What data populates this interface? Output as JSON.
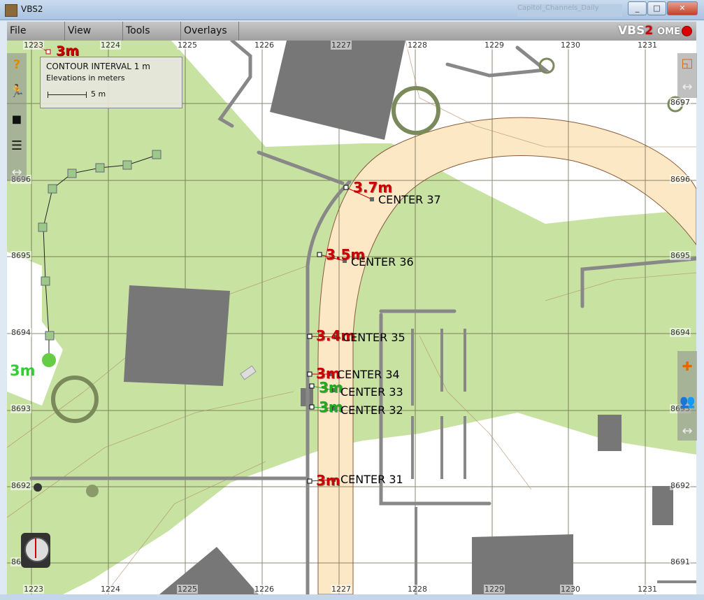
{
  "window": {
    "title": "VBS2",
    "blurred_text": "Capitol_Channels_Daily"
  },
  "menu": {
    "file": "File",
    "view": "View",
    "tools": "Tools",
    "overlays": "Overlays"
  },
  "logo": {
    "vbs": "VBS",
    "two": "2",
    "suffix": "OME"
  },
  "legend": {
    "title": "CONTOUR INTERVAL 1 m",
    "subtitle": "Elevations in meters",
    "scale_label": "5 m"
  },
  "grid": {
    "top_labels": [
      "1223",
      "1224",
      "1225",
      "1226",
      "1227",
      "1228",
      "1229",
      "1230",
      "1231"
    ],
    "bottom_labels": [
      "1223",
      "1224",
      "1225",
      "1226",
      "1227",
      "1228",
      "1229",
      "1230",
      "1231"
    ],
    "left_labels": [
      "8696",
      "8695",
      "8694",
      "8693",
      "8692",
      "8691"
    ],
    "right_labels": [
      "8697",
      "8696",
      "8695",
      "8694",
      "8693",
      "8692",
      "8691"
    ]
  },
  "markers": [
    {
      "name": "CENTER 37",
      "height": "3.7m",
      "color": "#cc0000"
    },
    {
      "name": "CENTER 36",
      "height": "3.5m",
      "color": "#cc0000"
    },
    {
      "name": "CENTER 35",
      "height": "3.4m",
      "color": "#cc0000"
    },
    {
      "name": "CENTER 34",
      "height": "3m",
      "color": "#cc0000"
    },
    {
      "name": "CENTER 33",
      "height": "3m",
      "color": "#22aa22"
    },
    {
      "name": "CENTER 32",
      "height": "3m",
      "color": "#22aa22"
    },
    {
      "name": "CENTER 31",
      "height": "3m",
      "color": "#cc0000"
    }
  ],
  "misc_labels": {
    "top_left_height": "3m",
    "left_green_height": "3m"
  },
  "colors": {
    "vegetation": "#c8e2a2",
    "road": "#fde8c6",
    "building": "#777777",
    "grid": "#5a5a3a",
    "path": "#888888"
  },
  "icons": {
    "left": [
      "help-icon",
      "soldier-icon",
      "layer-icon",
      "layers-icon",
      "resize-icon"
    ],
    "right_top": [
      "orange-square-icon",
      "resize-icon"
    ],
    "right_bottom": [
      "add-unit-icon",
      "group-icon",
      "resize-icon"
    ]
  }
}
